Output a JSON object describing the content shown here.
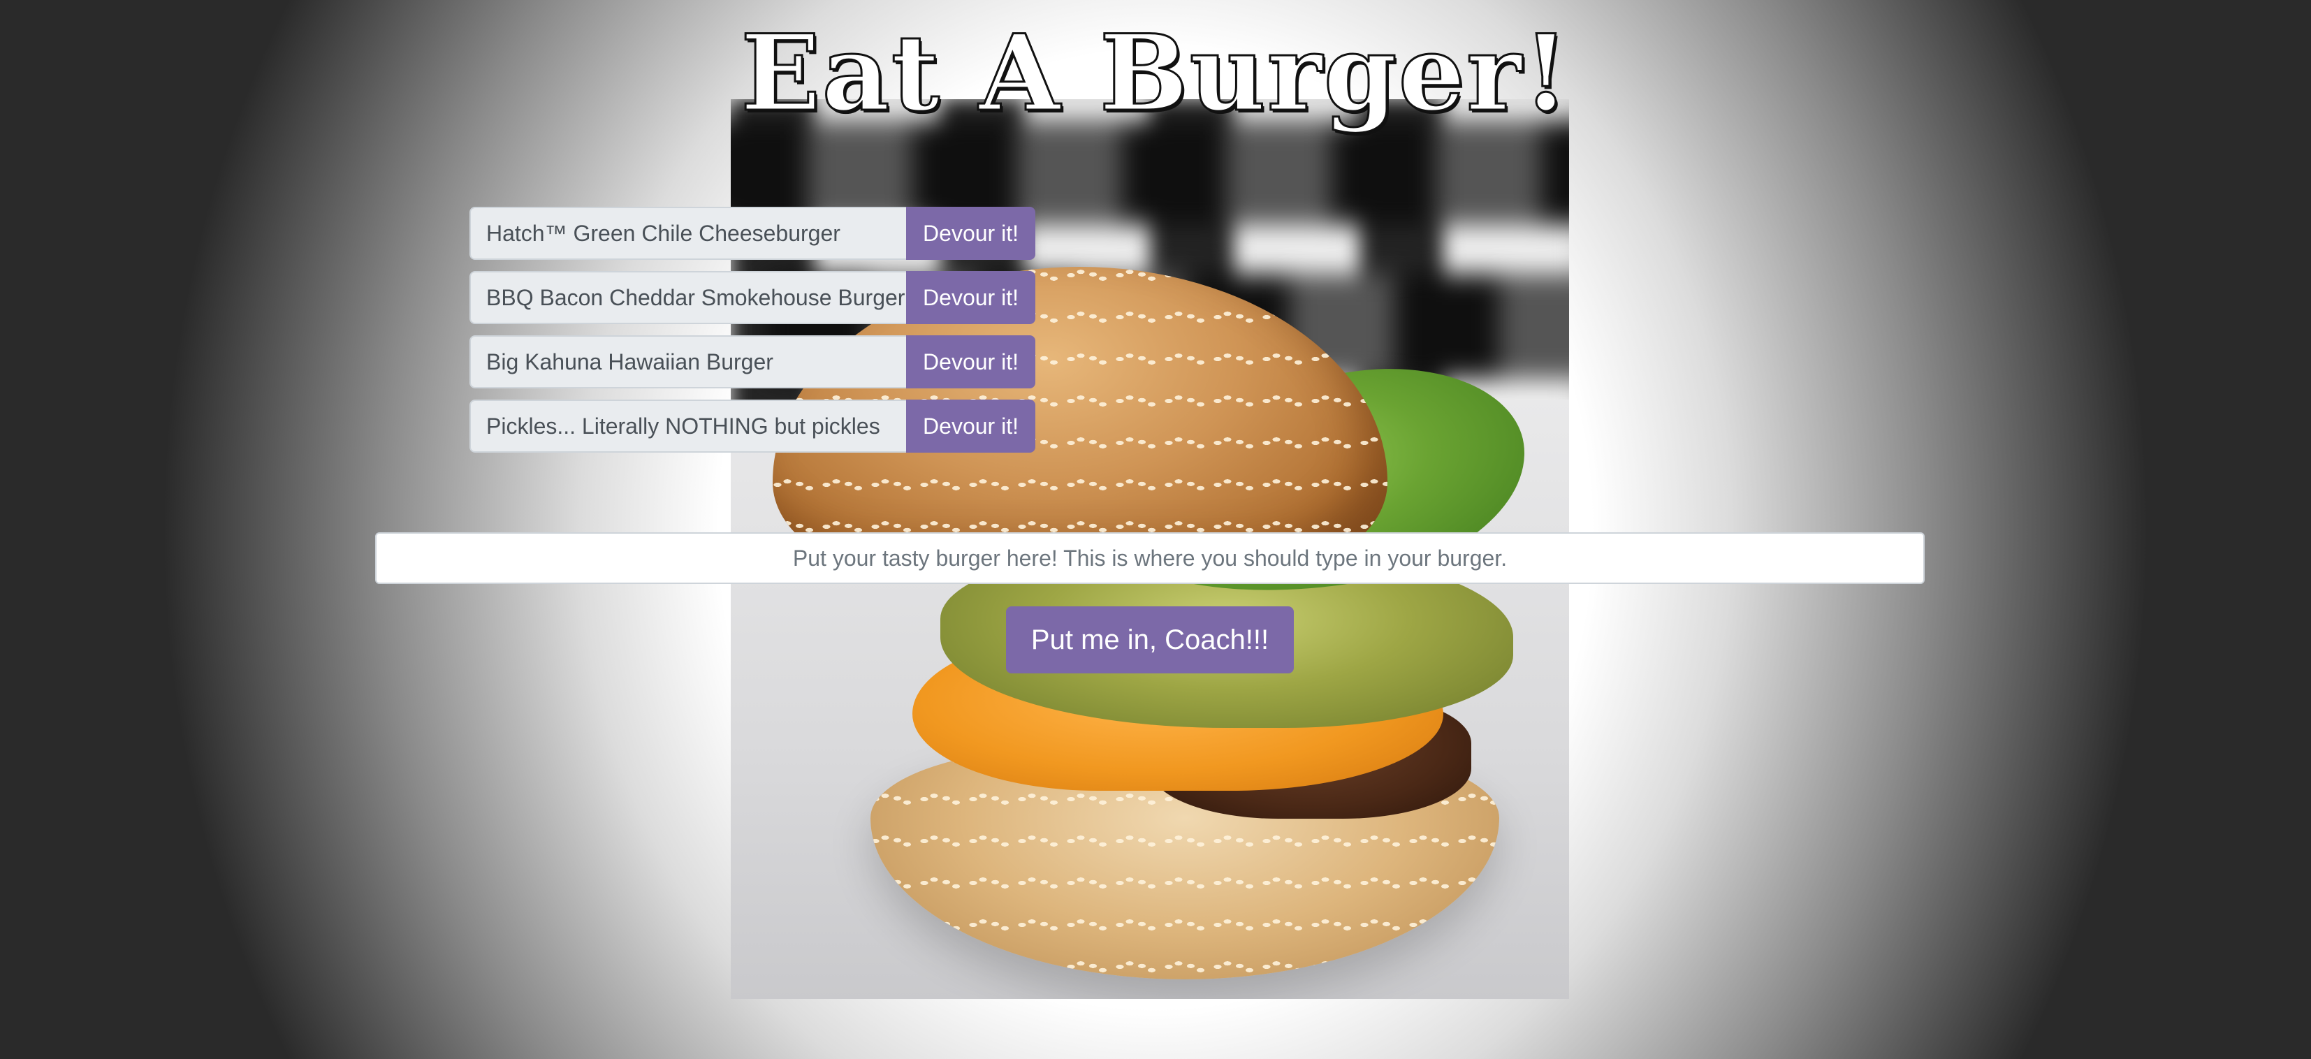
{
  "page": {
    "title": "Eat A Burger!"
  },
  "burgers": [
    {
      "name": "Hatch™ Green Chile Cheeseburger",
      "action_label": "Devour it!"
    },
    {
      "name": "BBQ Bacon Cheddar Smokehouse Burger",
      "action_label": "Devour it!"
    },
    {
      "name": "Big Kahuna Hawaiian Burger",
      "action_label": "Devour it!"
    },
    {
      "name": "Pickles... Literally NOTHING but pickles",
      "action_label": "Devour it!"
    }
  ],
  "form": {
    "input_value": "",
    "input_placeholder": "Put your tasty burger here! This is where you should type in your burger.",
    "submit_label": "Put me in, Coach!!!"
  },
  "colors": {
    "accent": "#7c69a8",
    "item_background": "#e9ecef",
    "title_fill": "#ffffff",
    "title_outline": "#111111"
  },
  "images": {
    "background_photo": "burger-photo"
  }
}
